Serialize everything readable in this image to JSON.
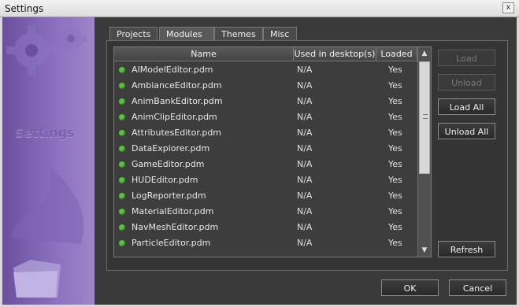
{
  "window": {
    "title": "Settings",
    "close_glyph": "x"
  },
  "sidebar": {
    "label": "Settings",
    "gear_icon": "gear-icon",
    "folder_icon": "folder-icon"
  },
  "tabs": [
    {
      "label": "Projects",
      "active": false
    },
    {
      "label": "Modules",
      "active": true
    },
    {
      "label": "Themes",
      "active": false
    },
    {
      "label": "Misc",
      "active": false
    }
  ],
  "table": {
    "columns": [
      "Name",
      "Used in desktop(s)",
      "Loaded"
    ],
    "rows": [
      {
        "name": "AIModelEditor.pdm",
        "used": "N/A",
        "loaded": "Yes"
      },
      {
        "name": "AmbianceEditor.pdm",
        "used": "N/A",
        "loaded": "Yes"
      },
      {
        "name": "AnimBankEditor.pdm",
        "used": "N/A",
        "loaded": "Yes"
      },
      {
        "name": "AnimClipEditor.pdm",
        "used": "N/A",
        "loaded": "Yes"
      },
      {
        "name": "AttributesEditor.pdm",
        "used": "N/A",
        "loaded": "Yes"
      },
      {
        "name": "DataExplorer.pdm",
        "used": "N/A",
        "loaded": "Yes"
      },
      {
        "name": "GameEditor.pdm",
        "used": "N/A",
        "loaded": "Yes"
      },
      {
        "name": "HUDEditor.pdm",
        "used": "N/A",
        "loaded": "Yes"
      },
      {
        "name": "LogReporter.pdm",
        "used": "N/A",
        "loaded": "Yes"
      },
      {
        "name": "MaterialEditor.pdm",
        "used": "N/A",
        "loaded": "Yes"
      },
      {
        "name": "NavMeshEditor.pdm",
        "used": "N/A",
        "loaded": "Yes"
      },
      {
        "name": "ParticleEditor.pdm",
        "used": "N/A",
        "loaded": "Yes"
      }
    ],
    "status_color": "#58c23a"
  },
  "buttons": {
    "load": "Load",
    "unload": "Unload",
    "load_all": "Load All",
    "unload_all": "Unload All",
    "refresh": "Refresh",
    "ok": "OK",
    "cancel": "Cancel"
  },
  "scrollbar": {
    "up_glyph": "▲",
    "down_glyph": "▼"
  }
}
